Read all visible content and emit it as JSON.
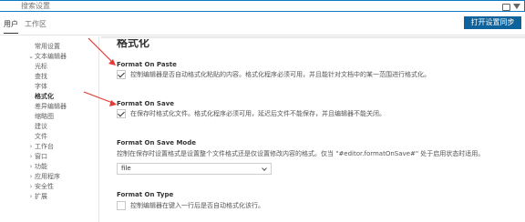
{
  "search": {
    "placeholder": "搜索设置",
    "icons": [
      "clear-settings-search-icon",
      "filter-icon"
    ]
  },
  "scope_tabs": [
    {
      "label": "用户",
      "active": true
    },
    {
      "label": "工作区",
      "active": false
    }
  ],
  "sync_button": {
    "label": "打开设置同步"
  },
  "toc": [
    {
      "label": "常用设置",
      "level": 1,
      "expand": "none",
      "active": false
    },
    {
      "label": "文本编辑器",
      "level": 0,
      "expand": "expanded",
      "active": false
    },
    {
      "label": "光标",
      "level": 2,
      "expand": "none",
      "active": false
    },
    {
      "label": "查找",
      "level": 2,
      "expand": "none",
      "active": false
    },
    {
      "label": "字体",
      "level": 2,
      "expand": "none",
      "active": false
    },
    {
      "label": "格式化",
      "level": 2,
      "expand": "none",
      "active": true
    },
    {
      "label": "差异编辑器",
      "level": 2,
      "expand": "none",
      "active": false
    },
    {
      "label": "缩略图",
      "level": 2,
      "expand": "none",
      "active": false
    },
    {
      "label": "建议",
      "level": 2,
      "expand": "none",
      "active": false
    },
    {
      "label": "文件",
      "level": 2,
      "expand": "none",
      "active": false
    },
    {
      "label": "工作台",
      "level": 0,
      "expand": "collapsed",
      "active": false
    },
    {
      "label": "窗口",
      "level": 0,
      "expand": "collapsed",
      "active": false
    },
    {
      "label": "功能",
      "level": 0,
      "expand": "collapsed",
      "active": false
    },
    {
      "label": "应用程序",
      "level": 0,
      "expand": "collapsed",
      "active": false
    },
    {
      "label": "安全性",
      "level": 0,
      "expand": "collapsed",
      "active": false
    },
    {
      "label": "扩展",
      "level": 0,
      "expand": "collapsed",
      "active": false
    }
  ],
  "section": {
    "title": "格式化"
  },
  "settings": {
    "format_on_paste": {
      "title": "Format On Paste",
      "description": "控制编辑器是否自动格式化粘贴的内容。格式化程序必须可用，并且能针对文档中的某一范围进行格式化。",
      "checked": true
    },
    "format_on_save": {
      "title": "Format On Save",
      "description": "在保存时格式化文件。格式化程序必须可用，延迟后文件不能保存，并且编辑器不能关闭。",
      "checked": true
    },
    "format_on_save_mode": {
      "title": "Format On Save Mode",
      "description": "控制在保存时设置格式是设置整个文件格式还是仅设置修改内容的格式。仅当 \"#editor.formatOnSave#\" 处于启用状态时适用。",
      "value": "file"
    },
    "format_on_type": {
      "title": "Format On Type",
      "description": "控制编辑器在键入一行后是否自动格式化该行。",
      "checked": false
    }
  },
  "annotation_color": "#e53935"
}
